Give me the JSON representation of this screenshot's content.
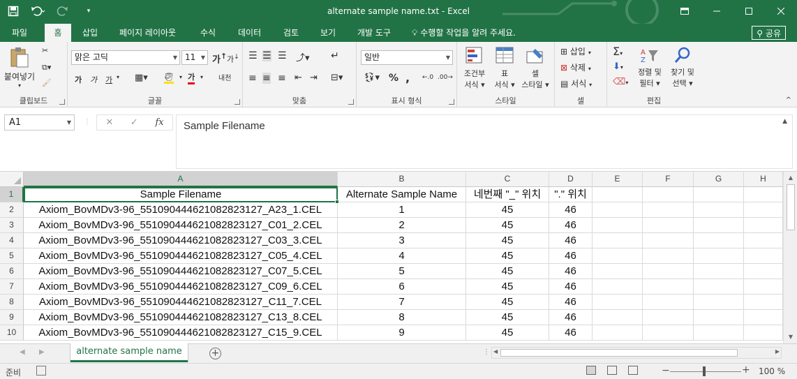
{
  "titlebar": {
    "title": "alternate sample name.txt - Excel",
    "save_icon": "save-icon",
    "undo_icon": "undo-icon",
    "redo_icon": "redo-icon",
    "customize_icon": "customize-qat-icon",
    "controls": [
      "ribbon-display-icon",
      "minimize-icon",
      "maximize-icon",
      "close-icon"
    ]
  },
  "tabs": {
    "items": [
      "파일",
      "홈",
      "삽입",
      "페이지 레이아웃",
      "수식",
      "데이터",
      "검토",
      "보기",
      "개발 도구"
    ],
    "active": "홈",
    "tell_me": "수행할 작업을 알려 주세요.",
    "share": "공유"
  },
  "ribbon": {
    "clipboard": {
      "paste": "붙여넣기",
      "label": "클립보드"
    },
    "font": {
      "name": "맑은 고딕",
      "size": "11",
      "grow": "가",
      "shrink": "가",
      "bold": "가",
      "italic": "가",
      "underline": "가",
      "font_color": "가",
      "phonetic": "내천",
      "label": "글꼴"
    },
    "alignment": {
      "label": "맞춤"
    },
    "number": {
      "format": "일반",
      "percent": "%",
      "comma": ",",
      "label": "표시 형식"
    },
    "styles": {
      "conditional": [
        "조건부",
        "서식 ▾"
      ],
      "table": [
        "표",
        "서식 ▾"
      ],
      "cell": [
        "셀",
        "스타일 ▾"
      ],
      "label": "스타일"
    },
    "cells": {
      "insert": "삽입",
      "delete": "삭제",
      "format": "서식",
      "label": "셀"
    },
    "editing": {
      "sort": [
        "정렬 및",
        "필터 ▾"
      ],
      "find": [
        "찾기 및",
        "선택 ▾"
      ],
      "label": "편집"
    }
  },
  "formula_bar": {
    "name_box": "A1",
    "cancel": "✕",
    "enter": "✓",
    "fx": "fx",
    "content": "Sample Filename"
  },
  "grid": {
    "columns": [
      "A",
      "B",
      "C",
      "D",
      "E",
      "F",
      "G",
      "H"
    ],
    "rows": [
      "1",
      "2",
      "3",
      "4",
      "5",
      "6",
      "7",
      "8",
      "9",
      "10"
    ],
    "cells": [
      [
        "Sample Filename",
        "Alternate Sample Name",
        "네번째 \"_\" 위치",
        "\".\" 위치"
      ],
      [
        "Axiom_BovMDv3-96_551090444621082823127_A23_1.CEL",
        "1",
        "45",
        "46"
      ],
      [
        "Axiom_BovMDv3-96_551090444621082823127_C01_2.CEL",
        "2",
        "45",
        "46"
      ],
      [
        "Axiom_BovMDv3-96_551090444621082823127_C03_3.CEL",
        "3",
        "45",
        "46"
      ],
      [
        "Axiom_BovMDv3-96_551090444621082823127_C05_4.CEL",
        "4",
        "45",
        "46"
      ],
      [
        "Axiom_BovMDv3-96_551090444621082823127_C07_5.CEL",
        "5",
        "45",
        "46"
      ],
      [
        "Axiom_BovMDv3-96_551090444621082823127_C09_6.CEL",
        "6",
        "45",
        "46"
      ],
      [
        "Axiom_BovMDv3-96_551090444621082823127_C11_7.CEL",
        "7",
        "45",
        "46"
      ],
      [
        "Axiom_BovMDv3-96_551090444621082823127_C13_8.CEL",
        "8",
        "45",
        "46"
      ],
      [
        "Axiom_BovMDv3-96_551090444621082823127_C15_9.CEL",
        "9",
        "45",
        "46"
      ]
    ]
  },
  "sheets": {
    "active": "alternate sample name"
  },
  "status": {
    "ready": "준비",
    "zoom": "100 %"
  },
  "colors": {
    "accent": "#217346"
  }
}
